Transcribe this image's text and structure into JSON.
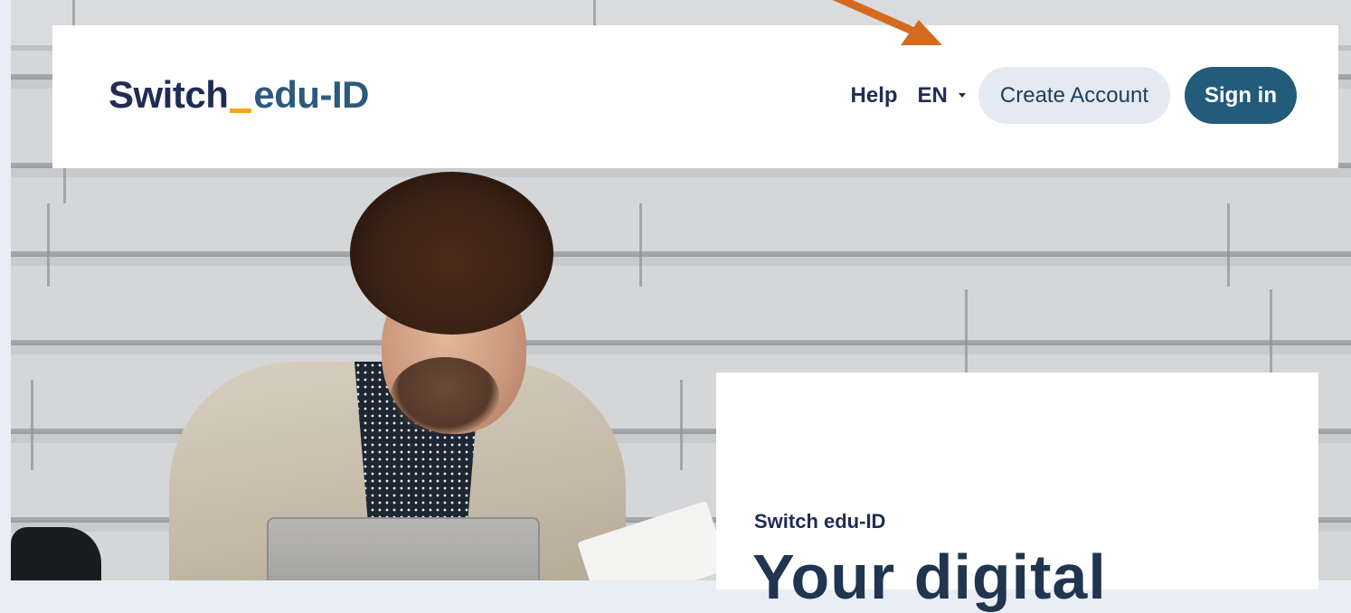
{
  "brand": {
    "name_part1": "Switch",
    "name_part2": "edu-ID",
    "accent_color": "#f4a71d",
    "primary_color": "#1f2d54"
  },
  "nav": {
    "help": "Help",
    "language": "EN",
    "create_account": "Create Account",
    "sign_in": "Sign in"
  },
  "hero": {
    "eyebrow": "Switch edu-ID",
    "title": "Your digital"
  },
  "annotation": {
    "arrow_color": "#d46a1f"
  }
}
